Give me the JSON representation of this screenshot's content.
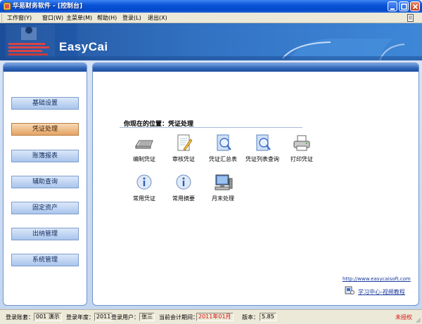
{
  "window": {
    "title": "华易财务软件 - [控制台]"
  },
  "menu": {
    "items": [
      "工作窗(Y)",
      "窗口(W)",
      "主菜单(M)",
      "帮助(H)",
      "登录(L)",
      "退出(X)"
    ]
  },
  "banner": {
    "brand": "EasyCai"
  },
  "sidebar": {
    "items": [
      "基础设置",
      "凭证处理",
      "账簿报表",
      "辅助查询",
      "固定资产",
      "出纳管理",
      "系统管理"
    ],
    "active_index": 1
  },
  "main": {
    "location": "你现在的位置：凭证处理",
    "tiles": [
      {
        "label": "编制凭证",
        "icon": "keyboard-icon"
      },
      {
        "label": "审核凭证",
        "icon": "edit-document-icon"
      },
      {
        "label": "凭证汇总表",
        "icon": "search-document-icon"
      },
      {
        "label": "凭证列表查询",
        "icon": "search-document-icon"
      },
      {
        "label": "打印凭证",
        "icon": "printer-icon"
      },
      {
        "label": "常用凭证",
        "icon": "info-icon"
      },
      {
        "label": "常用摘要",
        "icon": "info-icon"
      },
      {
        "label": "月末处理",
        "icon": "computer-icon"
      }
    ],
    "url": "http://www.easycaisoft.com",
    "video_link": "学习中心-视频教程"
  },
  "status": {
    "account_label": "登录账套：",
    "account_value": "001 演示",
    "year_label": "登录年度：",
    "year_value": "2011",
    "user_label": "登录用户：",
    "user_value": "张三",
    "period_label": "当前会计期间：",
    "period_value": "2011年01月",
    "version_label": "版本：",
    "version_value": "5.85",
    "license": "未授权"
  },
  "colors": {
    "accent": "#2a6fc4",
    "active_nav": "#e5a465",
    "title_bar": "#0a53d6"
  }
}
